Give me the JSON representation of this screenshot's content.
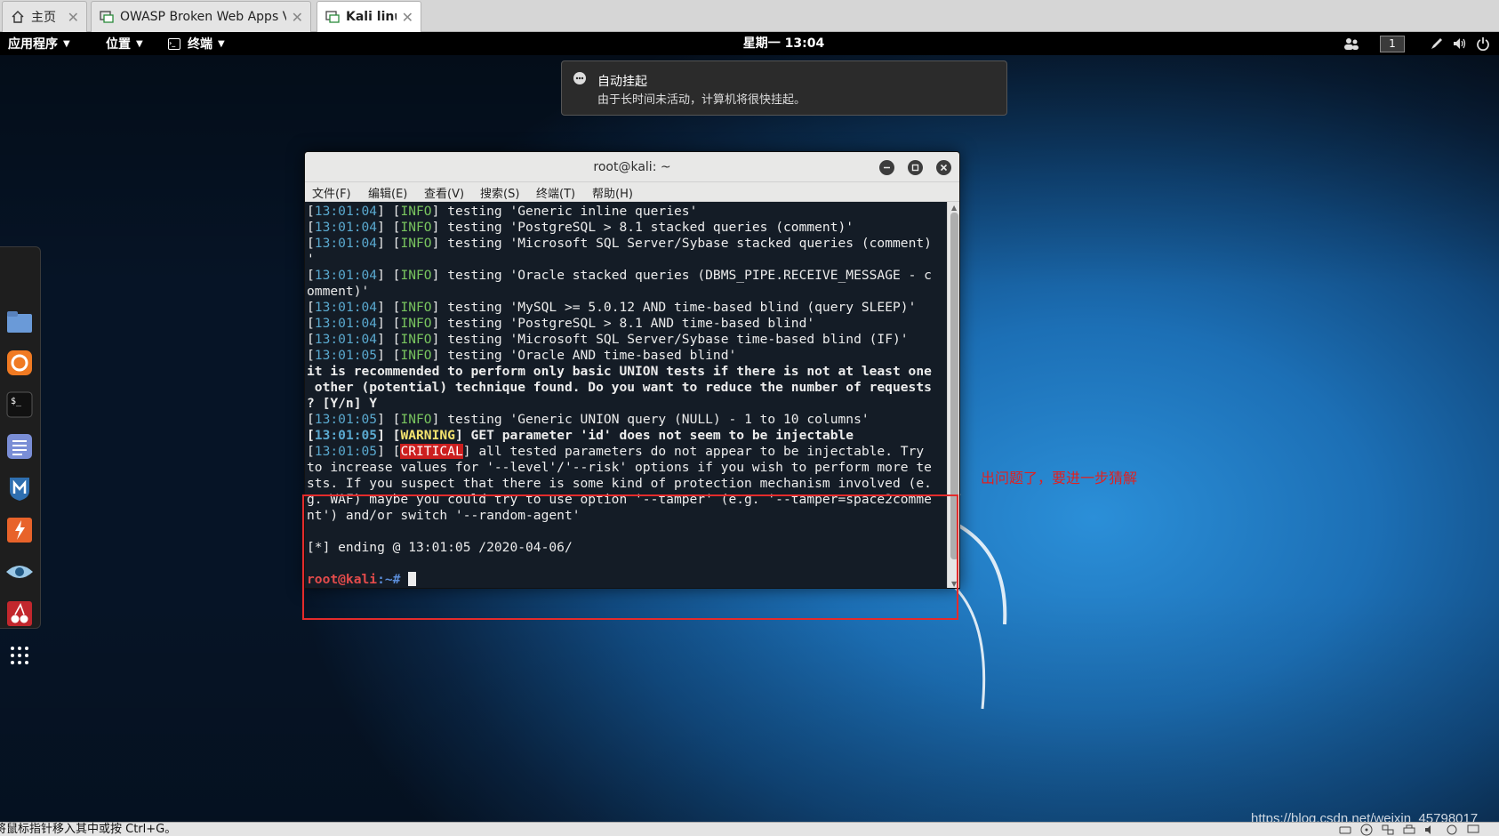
{
  "host_tabs": [
    {
      "label": "主页",
      "icon": "home-icon",
      "active": false
    },
    {
      "label": "OWASP Broken Web Apps VM v...",
      "icon": "vm-icon",
      "active": false
    },
    {
      "label": "Kali linux",
      "icon": "vm-icon",
      "active": true
    }
  ],
  "topbar": {
    "applications": "应用程序",
    "places": "位置",
    "terminal": "终端",
    "clock": "星期一 13:04",
    "workspace": "1"
  },
  "notification": {
    "title": "自动挂起",
    "body": "由于长时间未活动，计算机将很快挂起。"
  },
  "terminal": {
    "title": "root@kali: ~",
    "menu": [
      "文件(F)",
      "编辑(E)",
      "查看(V)",
      "搜索(S)",
      "终端(T)",
      "帮助(H)"
    ],
    "lines": {
      "l1_ts": "13:01:04",
      "l1_lvl": "INFO",
      "l1_msg": " testing 'Generic inline queries'",
      "l2_ts": "13:01:04",
      "l2_lvl": "INFO",
      "l2_msg": " testing 'PostgreSQL > 8.1 stacked queries (comment)'",
      "l3_ts": "13:01:04",
      "l3_lvl": "INFO",
      "l3_msg": " testing 'Microsoft SQL Server/Sybase stacked queries (comment)",
      "l4": "'",
      "l5_ts": "13:01:04",
      "l5_lvl": "INFO",
      "l5_msg": " testing 'Oracle stacked queries (DBMS_PIPE.RECEIVE_MESSAGE - c",
      "l6": "omment)'",
      "l7_ts": "13:01:04",
      "l7_lvl": "INFO",
      "l7_msg": " testing 'MySQL >= 5.0.12 AND time-based blind (query SLEEP)'",
      "l8_ts": "13:01:04",
      "l8_lvl": "INFO",
      "l8_msg": " testing 'PostgreSQL > 8.1 AND time-based blind'",
      "l9_ts": "13:01:04",
      "l9_lvl": "INFO",
      "l9_msg": " testing 'Microsoft SQL Server/Sybase time-based blind (IF)'",
      "l10_ts": "13:01:05",
      "l10_lvl": "INFO",
      "l10_msg": " testing 'Oracle AND time-based blind'",
      "l11": "it is recommended to perform only basic UNION tests if there is not at least one",
      "l12": " other (potential) technique found. Do you want to reduce the number of requests",
      "l13": "? [Y/n] Y",
      "l14_ts": "13:01:05",
      "l14_lvl": "INFO",
      "l14_msg": " testing 'Generic UNION query (NULL) - 1 to 10 columns'",
      "l15_ts": "13:01:05",
      "l15_lvl": "WARNING",
      "l15_msg": " GET parameter 'id' does not seem to be injectable",
      "l16_ts": "13:01:05",
      "l16_lvl": "CRITICAL",
      "l16_msg": " all tested parameters do not appear to be injectable. Try",
      "l17": "to increase values for '--level'/'--risk' options if you wish to perform more te",
      "l18": "sts. If you suspect that there is some kind of protection mechanism involved (e.",
      "l19": "g. WAF) maybe you could try to use option '--tamper' (e.g. '--tamper=space2comme",
      "l20": "nt') and/or switch '--random-agent'",
      "l21": "",
      "l22": "[*] ending @ 13:01:05 /2020-04-06/",
      "prompt_user": "root@kali",
      "prompt_path": ":~#"
    }
  },
  "annotation": "出问题了，要进一步猜解",
  "watermark": "https://blog.csdn.net/weixin_45798017",
  "statusbar": "将鼠标指针移入其中或按 Ctrl+G。"
}
